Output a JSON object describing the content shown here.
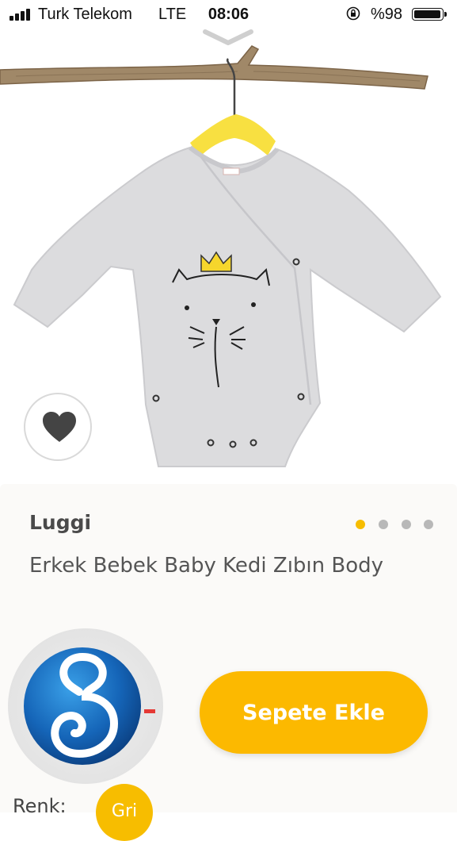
{
  "status_bar": {
    "carrier": "Turk Telekom",
    "network": "LTE",
    "time": "08:06",
    "battery_percent": "%98"
  },
  "product": {
    "brand": "Luggi",
    "name": "Erkek Bebek Baby Kedi Zıbın Body",
    "image_count": 4,
    "active_image_index": 0
  },
  "actions": {
    "add_to_cart_label": "Sepete Ekle"
  },
  "color": {
    "label": "Renk:",
    "selected": "Gri"
  },
  "colors": {
    "accent": "#fcb900",
    "card_background": "#fbfaf8",
    "dot_inactive": "#b8b8b8"
  },
  "icons": [
    "signal-icon",
    "orientation-lock-icon",
    "battery-icon",
    "chevron-down-icon",
    "heart-icon",
    "brand-logo-icon"
  ]
}
